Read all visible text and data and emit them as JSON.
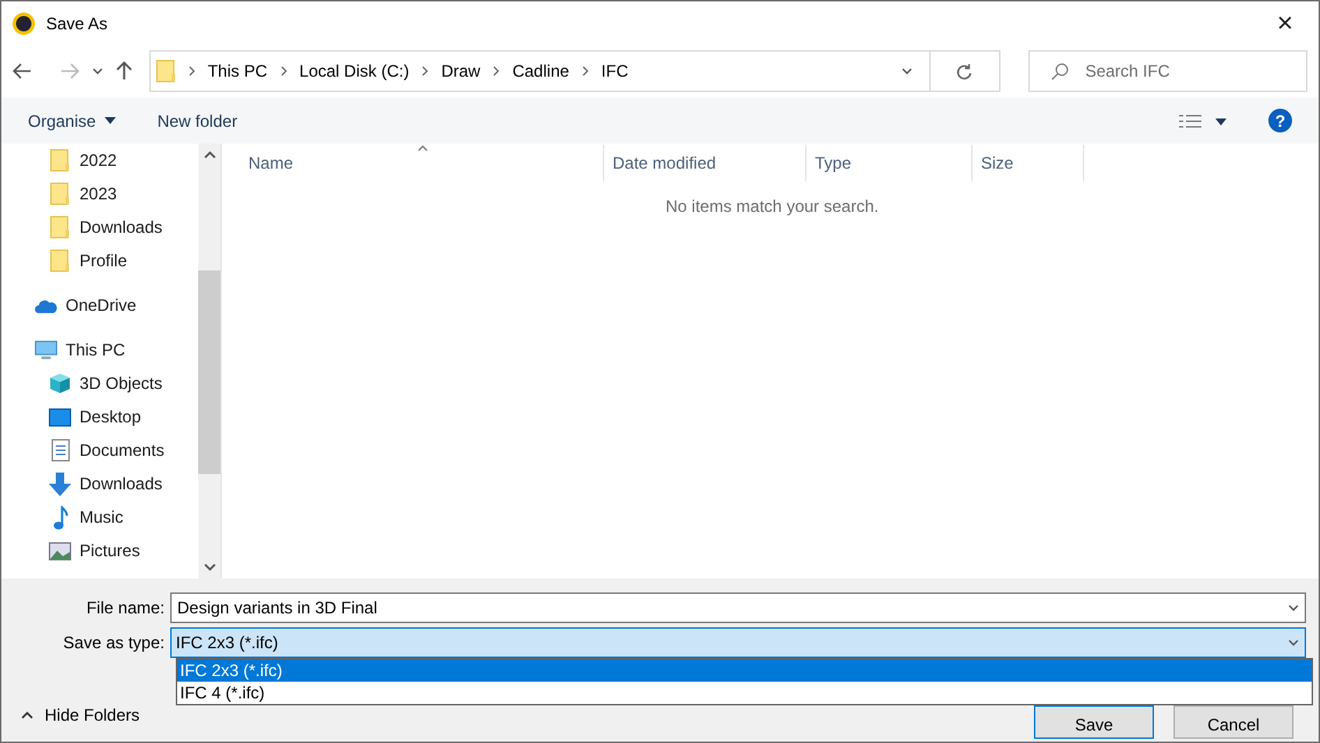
{
  "window": {
    "title": "Save As",
    "close": "×"
  },
  "breadcrumb": [
    "This PC",
    "Local Disk (C:)",
    "Draw",
    "Cadline",
    "IFC"
  ],
  "search": {
    "placeholder": "Search IFC"
  },
  "toolbar": {
    "organise": "Organise",
    "new_folder": "New folder",
    "help": "?"
  },
  "sidebar": {
    "items": [
      {
        "children": [
          {
            "label": "2022",
            "kind": "folder"
          },
          {
            "label": "2023",
            "kind": "folder"
          },
          {
            "label": "Downloads",
            "kind": "folder"
          },
          {
            "label": "Profile",
            "kind": "folder"
          }
        ]
      },
      {
        "label": "OneDrive",
        "kind": "cloud"
      },
      {
        "label": "This PC",
        "kind": "pc",
        "children": [
          {
            "label": "3D Objects",
            "kind": "cube"
          },
          {
            "label": "Desktop",
            "kind": "desktop"
          },
          {
            "label": "Documents",
            "kind": "documents"
          },
          {
            "label": "Downloads",
            "kind": "downloads"
          },
          {
            "label": "Music",
            "kind": "music"
          },
          {
            "label": "Pictures",
            "kind": "pictures"
          }
        ]
      }
    ]
  },
  "table": {
    "columns": [
      "Name",
      "Date modified",
      "Type",
      "Size"
    ],
    "empty_message": "No items match your search."
  },
  "file_name": {
    "label": "File name:",
    "value": "Design variants in 3D Final"
  },
  "save_as_type": {
    "label": "Save as type:",
    "value": "IFC 2x3 (*.ifc)",
    "expanded": true,
    "options": [
      {
        "label": "IFC 2x3 (*.ifc)",
        "selected": true
      },
      {
        "label": "IFC 4 (*.ifc)",
        "selected": false
      }
    ]
  },
  "hide_folders": "Hide Folders",
  "buttons": [
    "Save",
    "Cancel"
  ]
}
